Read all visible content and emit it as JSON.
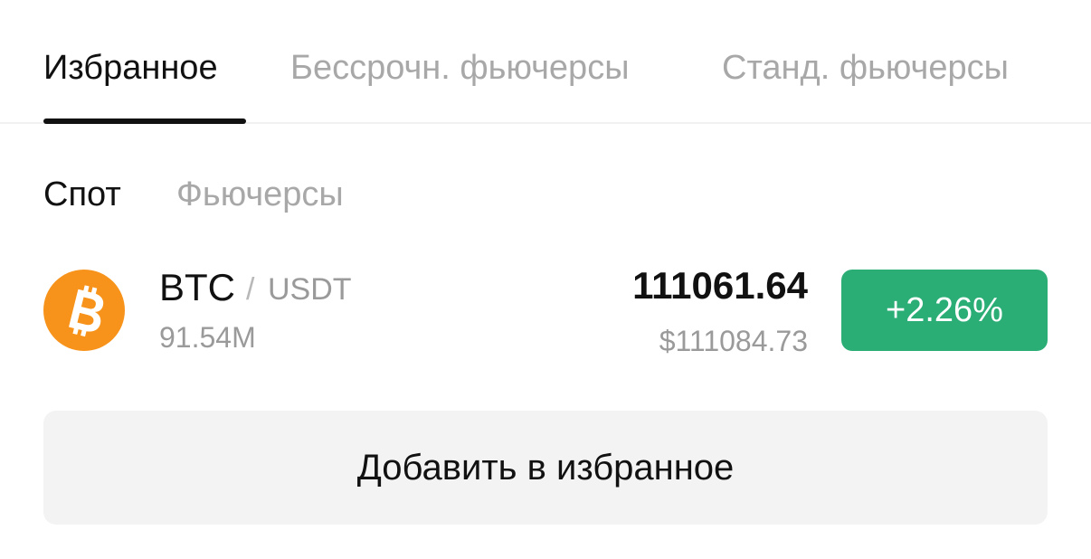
{
  "tabs": [
    {
      "label": "Избранное",
      "active": true
    },
    {
      "label": "Бессрочн. фьючерсы",
      "active": false
    },
    {
      "label": "Станд. фьючерсы",
      "active": false
    }
  ],
  "subtabs": [
    {
      "label": "Спот",
      "active": true
    },
    {
      "label": "Фьючерсы",
      "active": false
    }
  ],
  "ticker": {
    "icon": "bitcoin-icon",
    "icon_color": "#f7931a",
    "base": "BTC",
    "separator": "/",
    "quote": "USDT",
    "volume": "91.54M",
    "price": "111061.64",
    "price_usd": "$111084.73",
    "change": "+2.26%",
    "change_color": "#2bae76"
  },
  "add_button": {
    "label": "Добавить в избранное"
  }
}
